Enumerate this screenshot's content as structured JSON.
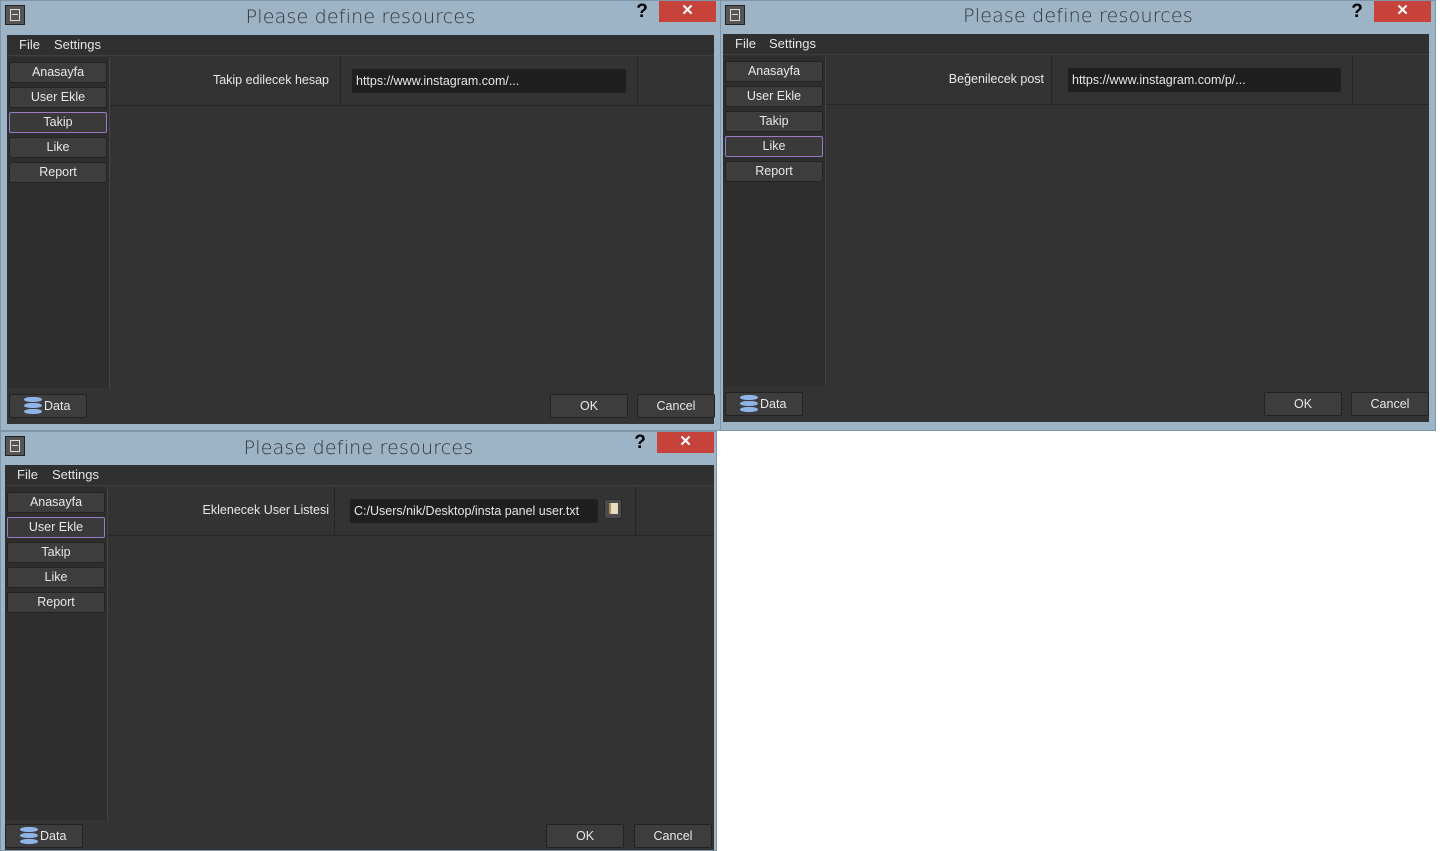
{
  "windows": [
    {
      "title": "Please define resources",
      "help": "?",
      "close": "✕",
      "menu": [
        "File",
        "Settings"
      ],
      "sidebar": [
        "Anasayfa",
        "User Ekle",
        "Takip",
        "Like",
        "Report"
      ],
      "active_index": 2,
      "field_label": "Takip edilecek hesap",
      "field_value": "https://www.instagram.com/...",
      "data_button": "Data",
      "ok": "OK",
      "cancel": "Cancel"
    },
    {
      "title": "Please define resources",
      "help": "?",
      "close": "✕",
      "menu": [
        "File",
        "Settings"
      ],
      "sidebar": [
        "Anasayfa",
        "User Ekle",
        "Takip",
        "Like",
        "Report"
      ],
      "active_index": 3,
      "field_label": "Beğenilecek post",
      "field_value": "https://www.instagram.com/p/...",
      "data_button": "Data",
      "ok": "OK",
      "cancel": "Cancel"
    },
    {
      "title": "Please define resources",
      "help": "?",
      "close": "✕",
      "menu": [
        "File",
        "Settings"
      ],
      "sidebar": [
        "Anasayfa",
        "User Ekle",
        "Takip",
        "Like",
        "Report"
      ],
      "active_index": 1,
      "field_label": "Eklenecek User Listesi",
      "field_value": "C:/Users/nik/Desktop/insta panel user.txt",
      "data_button": "Data",
      "ok": "OK",
      "cancel": "Cancel"
    }
  ],
  "colors": {
    "titlebar": "#9db3c6",
    "close": "#c7423a",
    "client": "#323232",
    "active_border": "#9a7bc9",
    "db_icon": "#8fb4e8"
  }
}
